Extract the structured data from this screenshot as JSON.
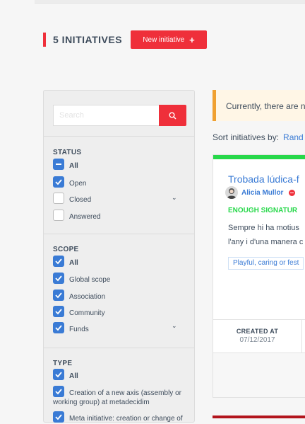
{
  "header": {
    "title": "5 INITIATIVES",
    "new_button_label": "New initiative",
    "new_button_icon": "plus-icon",
    "accent_color": "#ef2f3a"
  },
  "filters": {
    "search": {
      "placeholder": "Search",
      "value": "",
      "button_icon": "search-icon"
    },
    "status": {
      "title": "STATUS",
      "items": [
        {
          "label": "All",
          "state": "indeterminate"
        },
        {
          "label": "Open",
          "state": "checked"
        },
        {
          "label": "Closed",
          "state": "unchecked",
          "expandable": true
        },
        {
          "label": "Answered",
          "state": "unchecked"
        }
      ]
    },
    "scope": {
      "title": "SCOPE",
      "items": [
        {
          "label": "All",
          "state": "checked"
        },
        {
          "label": "Global scope",
          "state": "checked"
        },
        {
          "label": "Association",
          "state": "checked"
        },
        {
          "label": "Community",
          "state": "checked"
        },
        {
          "label": "Funds",
          "state": "checked",
          "expandable": true
        }
      ]
    },
    "type": {
      "title": "TYPE",
      "items": [
        {
          "label": "All",
          "state": "checked"
        },
        {
          "label": "Creation of a new axis (assembly or working group) at metadecidim",
          "state": "checked"
        },
        {
          "label": "Meta initiative: creation or change of",
          "state": "checked"
        }
      ]
    }
  },
  "notice": {
    "text": "Currently, there are n",
    "color": "#f0a030"
  },
  "sort": {
    "label": "Sort initiatives by:",
    "value": "Rand"
  },
  "initiative_card": {
    "status_color": "#27d84a",
    "title": "Trobada lúdica-f",
    "author": "Alicia Mullor",
    "state_label": "ENOUGH SIGNATUR",
    "description_lines": [
      "Sempre hi ha motius",
      "l'any i d'una manera c"
    ],
    "tag": "Playful, caring or fest",
    "created_label": "CREATED AT",
    "created_value": "07/12/2017"
  }
}
